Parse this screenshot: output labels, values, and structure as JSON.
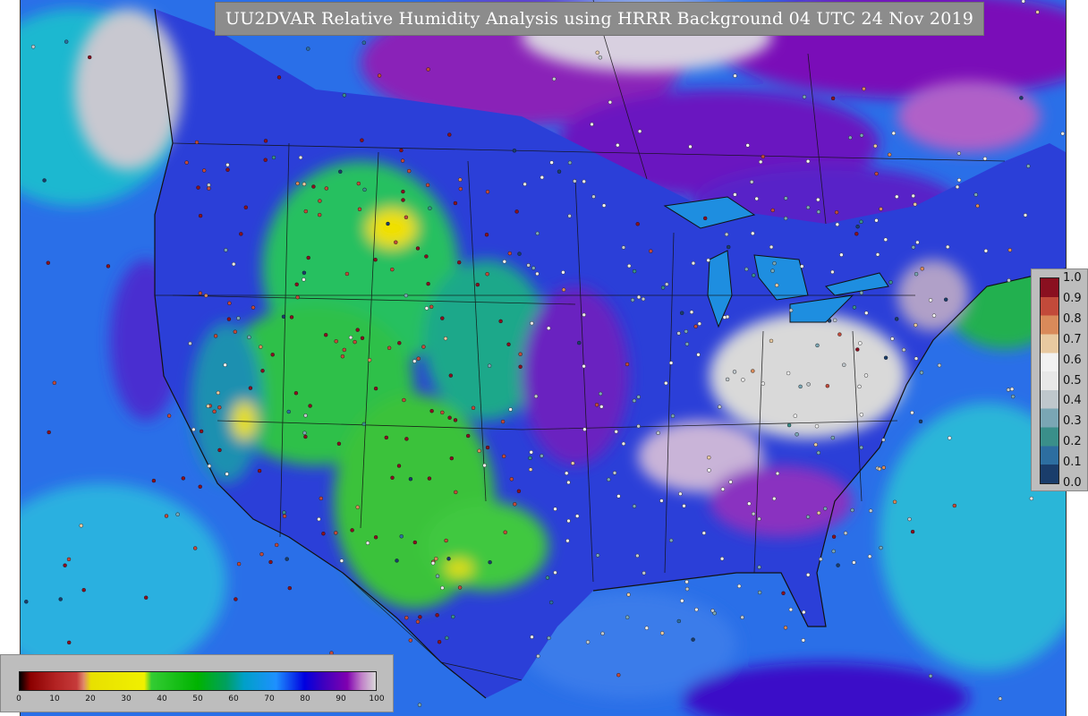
{
  "title": "UU2DVAR Relative Humidity Analysis using HRRR Background 04 UTC 24 Nov 2019",
  "colorbar_observations": {
    "ticks": [
      "0.0",
      "0.1",
      "0.2",
      "0.3",
      "0.4",
      "0.5",
      "0.6",
      "0.7",
      "0.8",
      "0.9",
      "1.0"
    ],
    "colors": [
      "#1a3d6b",
      "#2d6ea0",
      "#3a8f8a",
      "#7aa6b4",
      "#bfc7cc",
      "#e8e8e8",
      "#f2f2f2",
      "#e8c9a0",
      "#d98a5a",
      "#c24a3a",
      "#8a1020"
    ]
  },
  "colorbar_analysis": {
    "ticks": [
      "0",
      "10",
      "20",
      "30",
      "40",
      "50",
      "60",
      "70",
      "80",
      "90",
      "100"
    ],
    "stops": [
      {
        "v": 0,
        "c": "#000000"
      },
      {
        "v": 3,
        "c": "#8b0000"
      },
      {
        "v": 10,
        "c": "#b22222"
      },
      {
        "v": 16,
        "c": "#c63a3a"
      },
      {
        "v": 18,
        "c": "#e08a6a"
      },
      {
        "v": 20,
        "c": "#e8e000"
      },
      {
        "v": 35,
        "c": "#f0f000"
      },
      {
        "v": 37,
        "c": "#33cc33"
      },
      {
        "v": 50,
        "c": "#00b300"
      },
      {
        "v": 58,
        "c": "#00a060"
      },
      {
        "v": 63,
        "c": "#00a0c8"
      },
      {
        "v": 72,
        "c": "#1e90ff"
      },
      {
        "v": 80,
        "c": "#0000e0"
      },
      {
        "v": 85,
        "c": "#3a00c0"
      },
      {
        "v": 92,
        "c": "#8000b0"
      },
      {
        "v": 96,
        "c": "#c080c8"
      },
      {
        "v": 100,
        "c": "#d9d9d9"
      }
    ]
  }
}
